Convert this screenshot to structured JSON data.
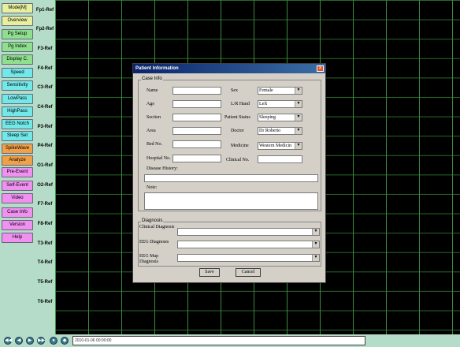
{
  "sidebar": {
    "buttons": [
      {
        "label": "Mode[M]",
        "color": "#e8f0a0"
      },
      {
        "label": "Overview",
        "color": "#e8f0a0"
      },
      {
        "label": "Pg Setup",
        "color": "#8ee08e"
      },
      {
        "label": "Pg Index",
        "color": "#8ee08e"
      },
      {
        "label": "Display C.",
        "color": "#8ee08e"
      },
      {
        "label": "Speed",
        "color": "#72e8e8"
      },
      {
        "label": "Sensitivity",
        "color": "#72e8e8"
      },
      {
        "label": "LowPass",
        "color": "#72e8e8"
      },
      {
        "label": "HighPass",
        "color": "#72e8e8"
      },
      {
        "label": "EEG Notch",
        "color": "#72e8e8"
      },
      {
        "label": "Sleep Set",
        "color": "#72e8e8"
      },
      {
        "label": "SpikeWave",
        "color": "#f0a048"
      },
      {
        "label": "Analyze",
        "color": "#f0a048"
      },
      {
        "label": "Pre-Event",
        "color": "#f090f0"
      },
      {
        "label": "Self-Event",
        "color": "#f090f0"
      },
      {
        "label": "Video",
        "color": "#f090f0"
      },
      {
        "label": "Case Info",
        "color": "#f090f0"
      },
      {
        "label": "Version",
        "color": "#f090f0"
      },
      {
        "label": "Help",
        "color": "#f090f0"
      }
    ]
  },
  "channels": [
    "Fp1-Ref",
    "Fp2-Ref",
    "F3-Ref",
    "F4-Ref",
    "C3-Ref",
    "C4-Ref",
    "P3-Ref",
    "P4-Ref",
    "O1-Ref",
    "O2-Ref",
    "F7-Ref",
    "F8-Ref",
    "T3-Ref",
    "T4-Ref",
    "T5-Ref",
    "T6-Ref"
  ],
  "bottom": {
    "timestamp": "2010-01-06 00:00:00",
    "nav": [
      "◀◀",
      "◀",
      "▶",
      "▶▶",
      "●",
      "◆"
    ]
  },
  "dialog": {
    "title": "Patient Information",
    "close": "X",
    "case_info": {
      "group": "Case Info",
      "name_label": "Name",
      "age_label": "Age",
      "section_label": "Section",
      "area_label": "Area",
      "bed_label": "Bed No.",
      "hospital_label": "Hospital No.",
      "sex_label": "Sex",
      "sex_value": "Female",
      "hand_label": "L/R Hand",
      "hand_value": "Left",
      "status_label": "Patient Status",
      "status_value": "Sleeping",
      "doctor_label": "Doctor",
      "doctor_value": "Dr Roberto",
      "medicine_label": "Medicine",
      "medicine_value": "Western Medicin",
      "clinical_label": "Clinical No.",
      "history_label": "Disease History:",
      "note_label": "Note:"
    },
    "diagnosis": {
      "group": "Diagnosis",
      "clinical_label": "Clinical Diagnosis",
      "eeg_label": "EEG Diagnosis",
      "eegmap_label_1": "EEG Map",
      "eegmap_label_2": "Diagnosis"
    },
    "save": "Save",
    "cancel": "Cancel"
  }
}
